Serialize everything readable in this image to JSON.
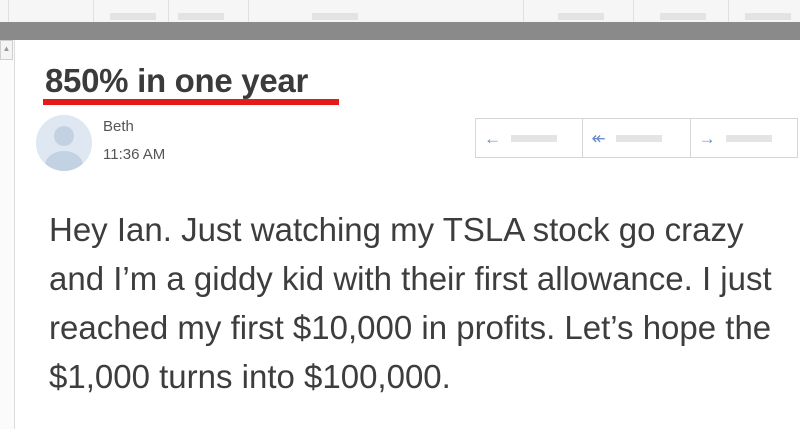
{
  "message": {
    "subject": "850% in one year",
    "sender": "Beth",
    "time": "11:36 AM",
    "body": "Hey Ian. Just watching my TSLA stock go crazy and I’m a giddy kid with their first allowance. I just reached my first $10,000 in profits. Let’s hope the $1,000 turns into $100,000."
  },
  "actions": {
    "reply_icon": "←",
    "reply_all_icon": "↞",
    "forward_icon": "→"
  },
  "colors": {
    "subject_underline": "#e51b1b",
    "arrow": "#6b8fc9",
    "top_bar": "#8a8a8a"
  },
  "icons": [
    "reply-arrow-icon",
    "reply-all-arrow-icon",
    "forward-arrow-icon",
    "avatar-person-icon"
  ]
}
